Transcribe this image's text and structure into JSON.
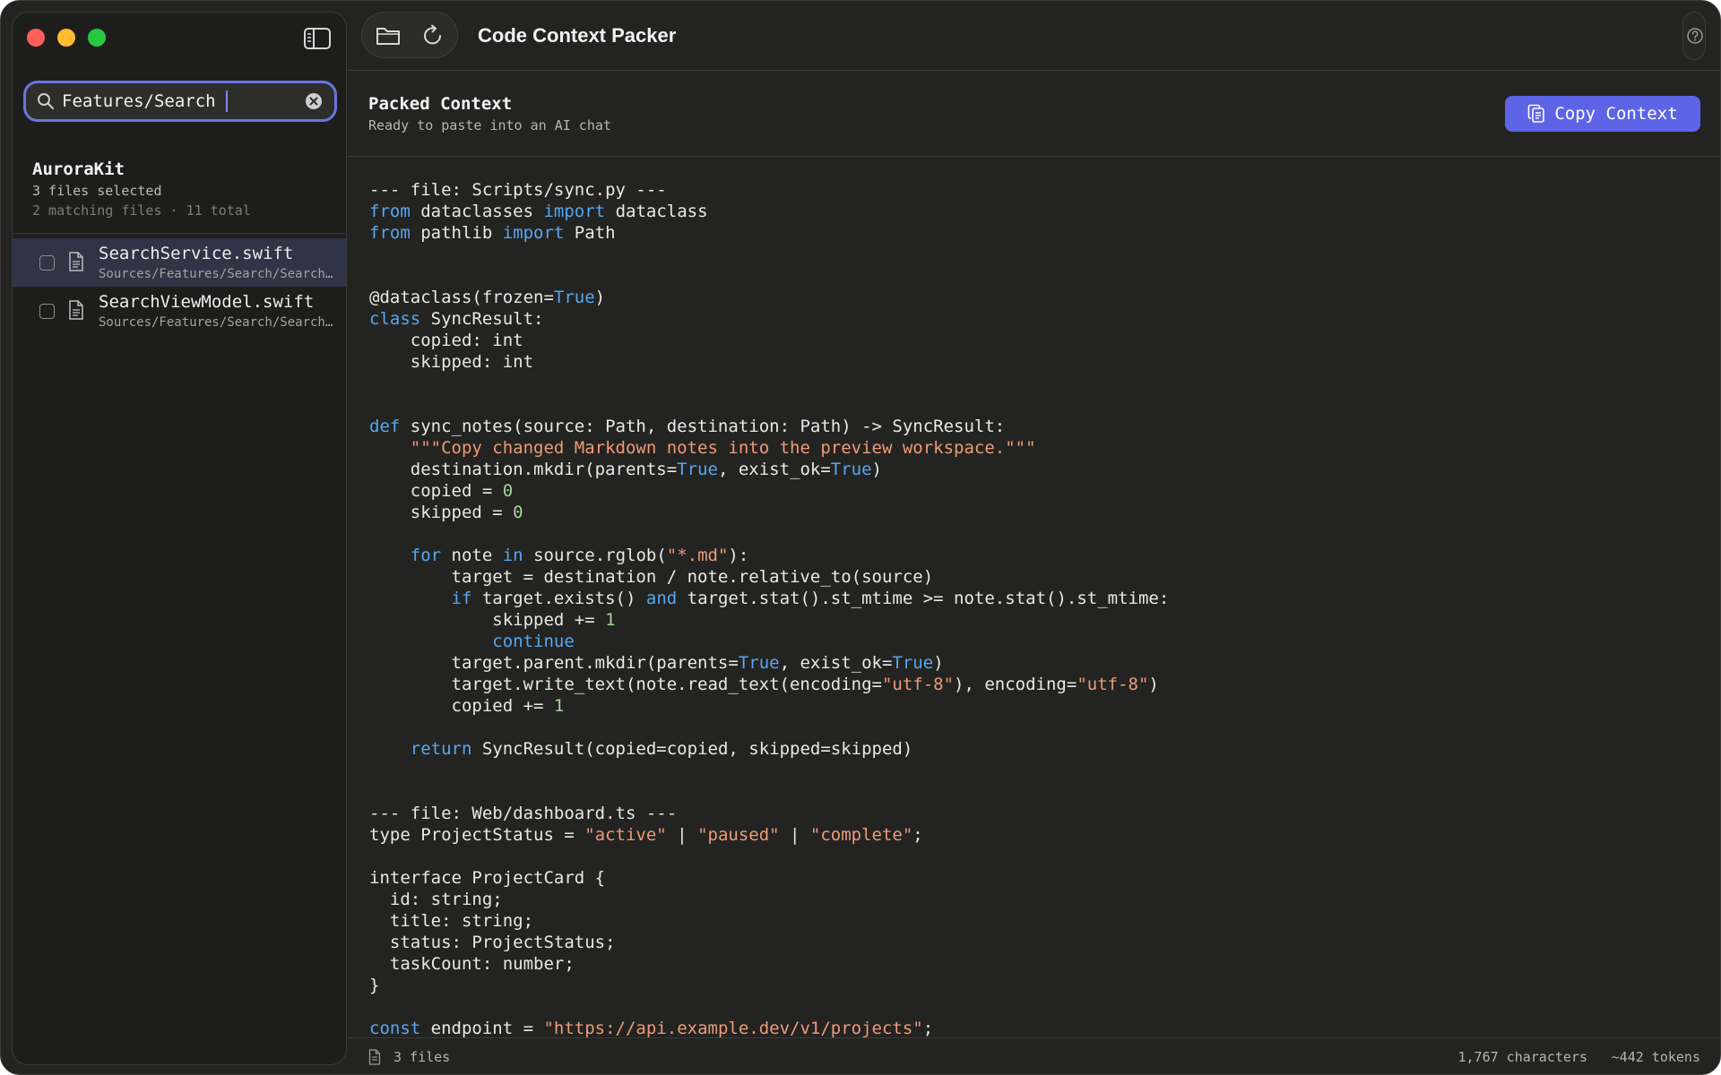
{
  "app": {
    "title": "Code Context Packer",
    "accent": "#5e64e6"
  },
  "window_controls": {
    "close_color": "#ff5f57",
    "minimize_color": "#febc2e",
    "zoom_color": "#28c840"
  },
  "sidebar": {
    "search": {
      "value": "Features/Search",
      "placeholder": ""
    },
    "project": {
      "name": "AuroraKit",
      "selected_summary": "3 files selected",
      "matching_summary": "2 matching files · 11 total"
    },
    "files": [
      {
        "name": "SearchService.swift",
        "path": "Sources/Features/Search/SearchService.swift",
        "checked": false,
        "selected": true
      },
      {
        "name": "SearchViewModel.swift",
        "path": "Sources/Features/Search/SearchViewModel.swift",
        "checked": false,
        "selected": false
      }
    ]
  },
  "toolbar": {
    "icons": [
      "sidebar-toggle-icon",
      "folder-icon",
      "refresh-icon",
      "help-icon"
    ]
  },
  "content": {
    "title": "Packed Context",
    "subtitle": "Ready to paste into an AI chat",
    "copy_button_label": "Copy Context",
    "code_lines": [
      [
        [
          "t",
          "--- file: Scripts/sync.py ---"
        ]
      ],
      [
        [
          "k",
          "from"
        ],
        [
          "t",
          " dataclasses "
        ],
        [
          "k",
          "import"
        ],
        [
          "t",
          " dataclass"
        ]
      ],
      [
        [
          "k",
          "from"
        ],
        [
          "t",
          " pathlib "
        ],
        [
          "k",
          "import"
        ],
        [
          "t",
          " Path"
        ]
      ],
      [],
      [],
      [
        [
          "t",
          "@dataclass(frozen="
        ],
        [
          "k",
          "True"
        ],
        [
          "t",
          ")"
        ]
      ],
      [
        [
          "k",
          "class"
        ],
        [
          "t",
          " SyncResult:"
        ]
      ],
      [
        [
          "t",
          "    copied: int"
        ]
      ],
      [
        [
          "t",
          "    skipped: int"
        ]
      ],
      [],
      [],
      [
        [
          "k",
          "def"
        ],
        [
          "t",
          " sync_notes(source: Path, destination: Path) -> SyncResult:"
        ]
      ],
      [
        [
          "t",
          "    "
        ],
        [
          "s",
          "\"\"\"Copy changed Markdown notes into the preview workspace.\"\"\""
        ]
      ],
      [
        [
          "t",
          "    destination.mkdir(parents="
        ],
        [
          "k",
          "True"
        ],
        [
          "t",
          ", exist_ok="
        ],
        [
          "k",
          "True"
        ],
        [
          "t",
          ")"
        ]
      ],
      [
        [
          "t",
          "    copied = "
        ],
        [
          "n",
          "0"
        ]
      ],
      [
        [
          "t",
          "    skipped = "
        ],
        [
          "n",
          "0"
        ]
      ],
      [],
      [
        [
          "t",
          "    "
        ],
        [
          "k",
          "for"
        ],
        [
          "t",
          " note "
        ],
        [
          "k",
          "in"
        ],
        [
          "t",
          " source.rglob("
        ],
        [
          "s",
          "\"*.md\""
        ],
        [
          "t",
          "):"
        ]
      ],
      [
        [
          "t",
          "        target = destination / note.relative_to(source)"
        ]
      ],
      [
        [
          "t",
          "        "
        ],
        [
          "k",
          "if"
        ],
        [
          "t",
          " target.exists() "
        ],
        [
          "k",
          "and"
        ],
        [
          "t",
          " target.stat().st_mtime >= note.stat().st_mtime:"
        ]
      ],
      [
        [
          "t",
          "            skipped += "
        ],
        [
          "n",
          "1"
        ]
      ],
      [
        [
          "t",
          "            "
        ],
        [
          "k",
          "continue"
        ]
      ],
      [
        [
          "t",
          "        target.parent.mkdir(parents="
        ],
        [
          "k",
          "True"
        ],
        [
          "t",
          ", exist_ok="
        ],
        [
          "k",
          "True"
        ],
        [
          "t",
          ")"
        ]
      ],
      [
        [
          "t",
          "        target.write_text(note.read_text(encoding="
        ],
        [
          "s",
          "\"utf-8\""
        ],
        [
          "t",
          "), encoding="
        ],
        [
          "s",
          "\"utf-8\""
        ],
        [
          "t",
          ")"
        ]
      ],
      [
        [
          "t",
          "        copied += "
        ],
        [
          "n",
          "1"
        ]
      ],
      [],
      [
        [
          "t",
          "    "
        ],
        [
          "k",
          "return"
        ],
        [
          "t",
          " SyncResult(copied=copied, skipped=skipped)"
        ]
      ],
      [],
      [],
      [
        [
          "t",
          "--- file: Web/dashboard.ts ---"
        ]
      ],
      [
        [
          "t",
          "type ProjectStatus = "
        ],
        [
          "s",
          "\"active\""
        ],
        [
          "t",
          " | "
        ],
        [
          "s",
          "\"paused\""
        ],
        [
          "t",
          " | "
        ],
        [
          "s",
          "\"complete\""
        ],
        [
          "t",
          ";"
        ]
      ],
      [],
      [
        [
          "t",
          "interface ProjectCard {"
        ]
      ],
      [
        [
          "t",
          "  id: string;"
        ]
      ],
      [
        [
          "t",
          "  title: string;"
        ]
      ],
      [
        [
          "t",
          "  status: ProjectStatus;"
        ]
      ],
      [
        [
          "t",
          "  taskCount: number;"
        ]
      ],
      [
        [
          "t",
          "}"
        ]
      ],
      [],
      [
        [
          "k",
          "const"
        ],
        [
          "t",
          " endpoint = "
        ],
        [
          "s",
          "\"https://api.example.dev/v1/projects\""
        ],
        [
          "t",
          ";"
        ]
      ]
    ]
  },
  "status_bar": {
    "files": "3 files",
    "characters": "1,767 characters",
    "tokens": "~442 tokens"
  }
}
